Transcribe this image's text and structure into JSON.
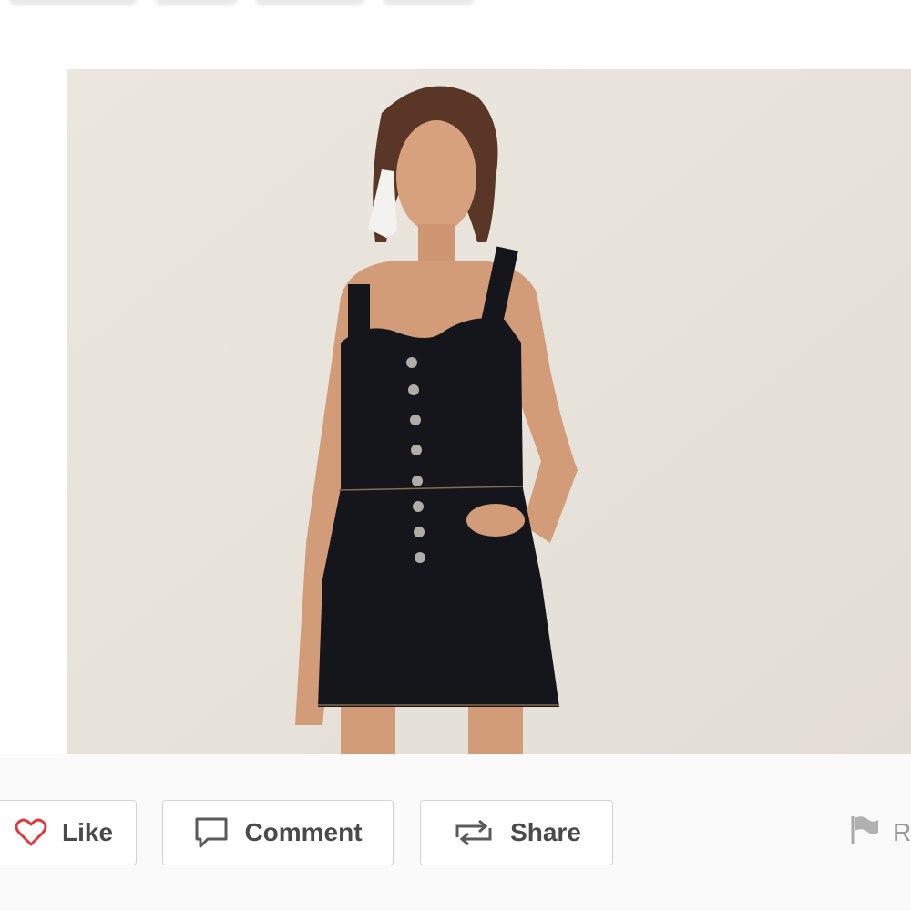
{
  "actions": {
    "like": {
      "label": "Like",
      "icon": "heart-icon",
      "icon_color": "#e0393e"
    },
    "comment": {
      "label": "Comment",
      "icon": "speech-bubble-icon"
    },
    "share": {
      "label": "Share",
      "icon": "repost-arrows-icon"
    },
    "report": {
      "label": "R",
      "icon": "flag-icon"
    }
  },
  "colors": {
    "photo_background": "#e8e4dc",
    "dress": "#15161c",
    "text": "#4a4a4a",
    "muted": "#9a9a9a"
  }
}
